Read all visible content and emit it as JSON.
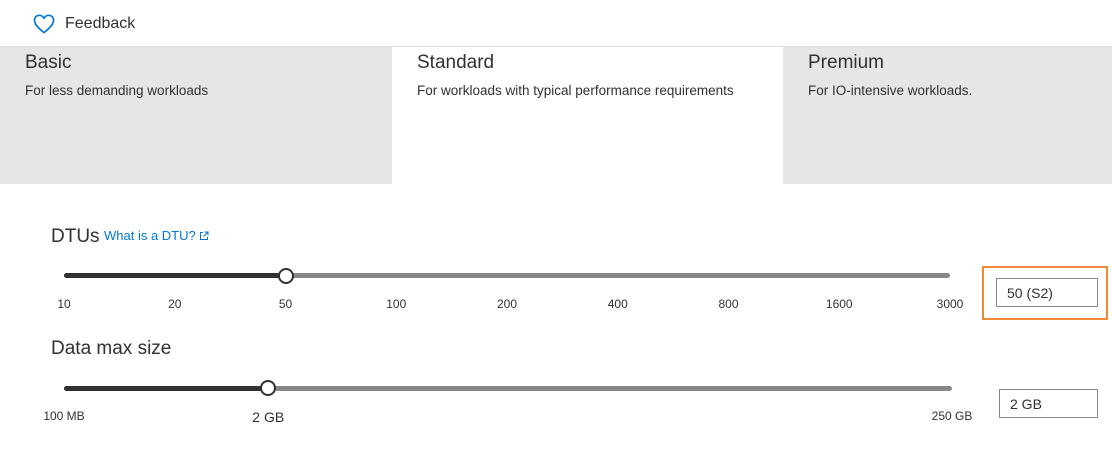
{
  "header": {
    "feedback_label": "Feedback"
  },
  "tiers": [
    {
      "name": "Basic",
      "description": "For less demanding workloads"
    },
    {
      "name": "Standard",
      "description": "For workloads with typical performance requirements"
    },
    {
      "name": "Premium",
      "description": "For IO-intensive workloads."
    }
  ],
  "selected_tier": "Standard",
  "dtu": {
    "label": "DTUs",
    "help_link": "What is a DTU?",
    "ticks": [
      "10",
      "20",
      "50",
      "100",
      "200",
      "400",
      "800",
      "1600",
      "3000"
    ],
    "selected_tick_index": 2,
    "value": "50 (S2)"
  },
  "data_max_size": {
    "label": "Data max size",
    "min_label": "100 MB",
    "max_label": "250 GB",
    "current_label": "2 GB",
    "slider_fraction": 0.23,
    "value": "2 GB"
  },
  "colors": {
    "accent": "#0078d4",
    "highlight": "#f28a35",
    "tier_inactive_bg": "#e6e6e6",
    "slider_active": "#323130",
    "slider_track": "#8a8886"
  },
  "icons": {
    "feedback": "heart-icon",
    "link": "external-link-icon"
  }
}
